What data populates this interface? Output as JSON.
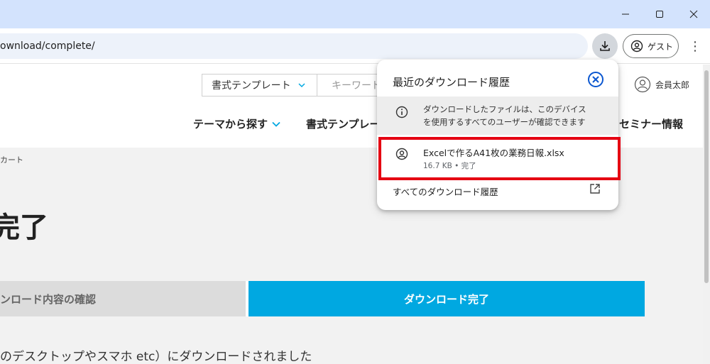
{
  "browser": {
    "url": "ownload/complete/",
    "guest_label": "ゲスト",
    "window_controls": [
      "minimize-icon",
      "maximize-icon",
      "close-icon"
    ]
  },
  "site": {
    "format_select": "書式テンプレート",
    "keyword_placeholder": "キーワード",
    "member_name": "会員太郎",
    "nav": [
      "テーマから探す",
      "書式テンプレー",
      "セミナー情報"
    ],
    "breadcrumb": "カート",
    "page_title": "完了",
    "steps": [
      "ンロード内容の確認",
      "ダウンロード完了"
    ],
    "note": "のデスクトップやスマホ etc）にダウンロードされました"
  },
  "download_bubble": {
    "title": "最近のダウンロード履歴",
    "info": "ダウンロードしたファイルは、このデバイスを使用するすべてのユーザーが確認できます",
    "file_name": "Excelで作るA41枚の業務日報.xlsx",
    "file_meta": "16.7 KB • 完了",
    "all_history": "すべてのダウンロード履歴"
  },
  "colors": {
    "accent": "#1a73e8",
    "step_active": "#00a8e1",
    "highlight": "#e50012"
  }
}
